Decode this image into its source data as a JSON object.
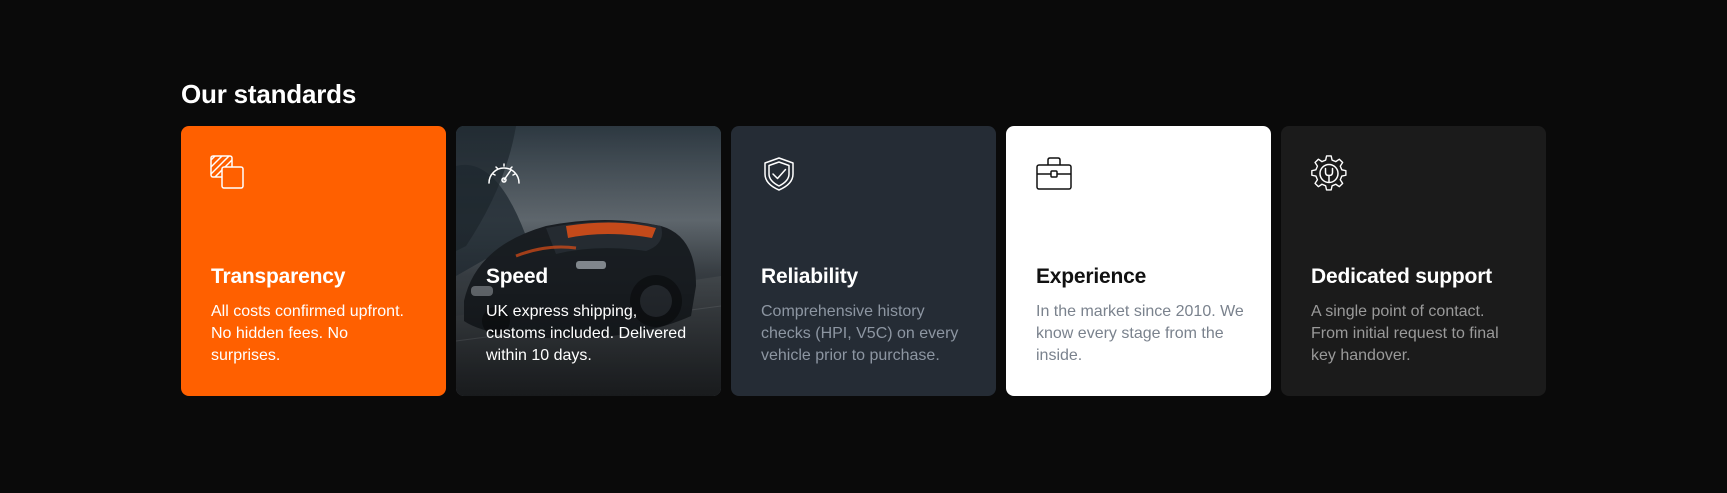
{
  "section": {
    "title": "Our standards"
  },
  "cards": [
    {
      "title": "Transparency",
      "text": "All costs confirmed upfront. No hidden fees. No surprises.",
      "icon": "overlapping-squares-icon",
      "color": "#ff6000"
    },
    {
      "title": "Speed",
      "text": "UK express shipping, customs included. Delivered within 10 days.",
      "icon": "speedometer-icon",
      "image": "sports-car-photo"
    },
    {
      "title": "Reliability",
      "text": "Comprehensive history checks (HPI, V5C) on every vehicle prior to purchase.",
      "icon": "shield-check-icon",
      "color": "#252c35"
    },
    {
      "title": "Experience",
      "text": "In the market since 2010. We know every stage from the inside.",
      "icon": "briefcase-icon",
      "color": "#ffffff"
    },
    {
      "title": "Dedicated support",
      "text": "A single point of contact. From initial request to final key handover.",
      "icon": "gear-wrench-icon",
      "color": "#1b1b1b"
    }
  ],
  "colors": {
    "page_background": "#0a0a0a",
    "accent": "#ff6000"
  }
}
